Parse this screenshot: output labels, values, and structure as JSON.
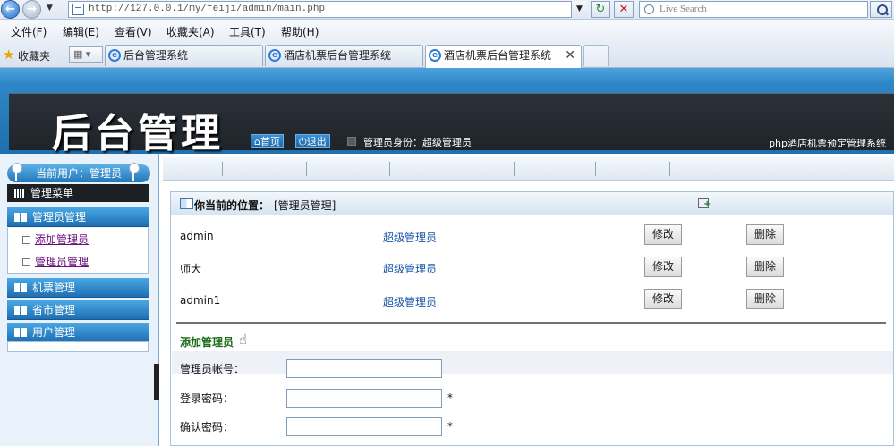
{
  "browser": {
    "url": "http://127.0.0.1/my/feiji/admin/main.php",
    "search_placeholder": "Live Search",
    "menu": [
      "文件(F)",
      "编辑(E)",
      "查看(V)",
      "收藏夹(A)",
      "工具(T)",
      "帮助(H)"
    ],
    "favorites_label": "收藏夹",
    "tabs": [
      {
        "label": "后台管理系统"
      },
      {
        "label": "酒店机票后台管理系统"
      },
      {
        "label": "酒店机票后台管理系统"
      }
    ]
  },
  "header": {
    "title": "后台管理",
    "home_label": "首页",
    "logout_label": "退出",
    "role_text": "管理员身份：超级管理员",
    "system_name": "php酒店机票预定管理系统"
  },
  "sidebar": {
    "current_user": "当前用户：管理员",
    "menu_title": "管理菜单",
    "sections": [
      {
        "label": "管理员管理",
        "items": [
          "添加管理员",
          "管理员管理"
        ]
      },
      {
        "label": "机票管理"
      },
      {
        "label": "省市管理"
      },
      {
        "label": "用户管理"
      }
    ]
  },
  "content": {
    "location_label": "你当前的位置：",
    "location_value": "[管理员管理]",
    "admins": [
      {
        "name": "admin",
        "role": "超级管理员",
        "edit": "修改",
        "delete": "删除"
      },
      {
        "name": "师大",
        "role": "超级管理员",
        "edit": "修改",
        "delete": "删除"
      },
      {
        "name": "admin1",
        "role": "超级管理员",
        "edit": "修改",
        "delete": "删除"
      }
    ],
    "add_title": "添加管理员",
    "form": {
      "account_label": "管理员帐号：",
      "password_label": "登录密码：",
      "confirm_label": "确认密码：",
      "account_value": "",
      "password_value": "",
      "confirm_value": "",
      "required_mark": "*"
    }
  }
}
